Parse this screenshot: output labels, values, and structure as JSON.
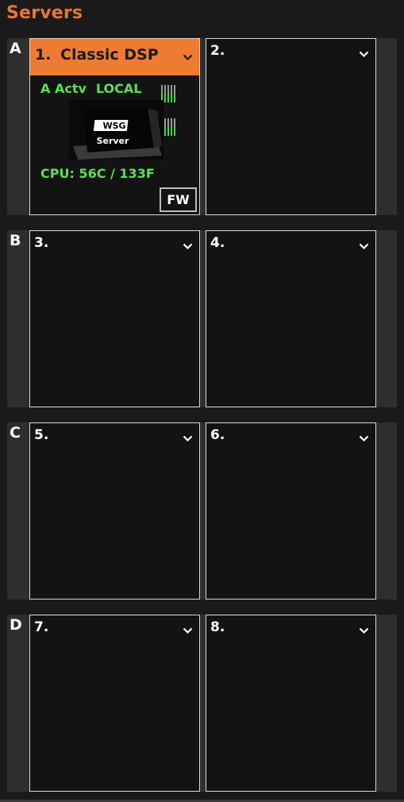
{
  "panel": {
    "title": "Servers"
  },
  "groups": [
    {
      "letter": "A",
      "slots": [
        {
          "number": "1.",
          "name": "Classic DSP",
          "active": true
        },
        {
          "number": "2.",
          "name": ""
        }
      ]
    },
    {
      "letter": "B",
      "slots": [
        {
          "number": "3.",
          "name": ""
        },
        {
          "number": "4.",
          "name": ""
        }
      ]
    },
    {
      "letter": "C",
      "slots": [
        {
          "number": "5.",
          "name": ""
        },
        {
          "number": "6.",
          "name": ""
        }
      ]
    },
    {
      "letter": "D",
      "slots": [
        {
          "number": "7.",
          "name": ""
        },
        {
          "number": "8.",
          "name": ""
        }
      ]
    }
  ],
  "active_server": {
    "activity": "A Actv",
    "location": "LOCAL",
    "cpu_label": "CPU: 56C / 133F",
    "fw_label": "FW",
    "logo_text": "WSG",
    "device_text": "Server",
    "meter_levels": [
      0.5,
      0.5,
      0.5,
      0.5,
      0.5
    ]
  },
  "colors": {
    "accent": "#ee7b32",
    "status_green": "#5ee04f",
    "slot_bg": "#131313",
    "group_bg": "#2e2e2e"
  },
  "icons": {
    "dropdown": "chevron-down-icon",
    "meter": "level-meter-icon"
  }
}
